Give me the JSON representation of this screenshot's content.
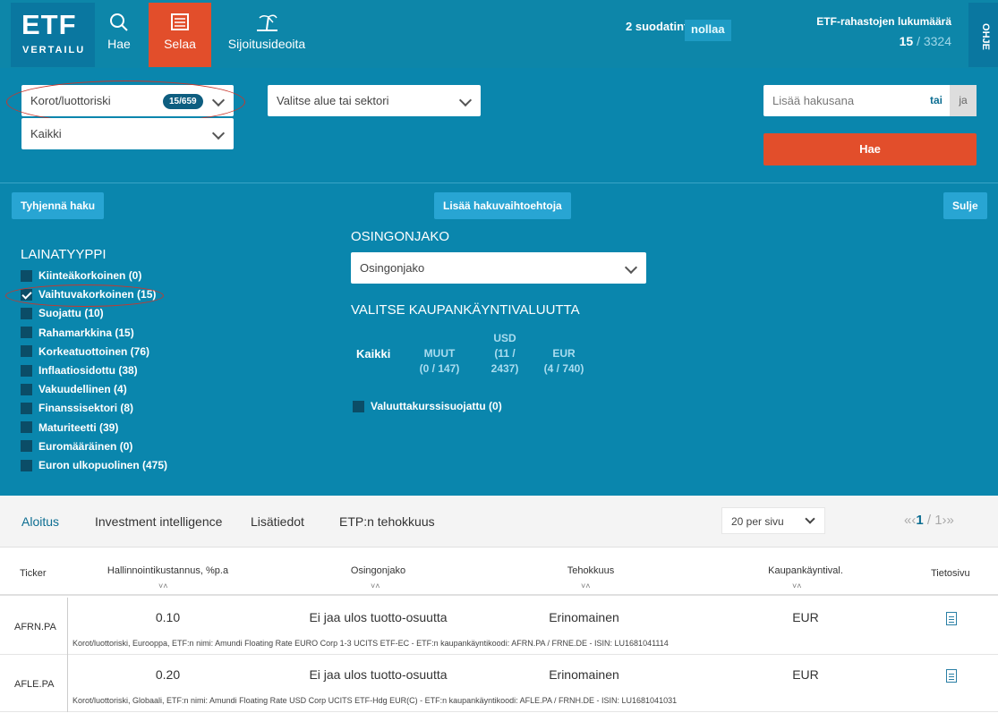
{
  "logo": {
    "title": "ETF",
    "subtitle": "VERTAILU"
  },
  "nav": {
    "hae": {
      "label": "Hae",
      "icon": "search-icon"
    },
    "selaa": {
      "label": "Selaa",
      "icon": "list-icon"
    },
    "sijoitusideoita": {
      "label": "Sijoitusideoita",
      "icon": "palm-island-icon"
    }
  },
  "filters": {
    "count_text": "2 suodatinta",
    "reset_label": "nollaa"
  },
  "fund_count": {
    "title": "ETF-rahastojen lukumäärä",
    "shown": "15",
    "total": "/ 3324"
  },
  "ohje": "OHJE",
  "search": {
    "category": {
      "value": "Korot/luottoriski",
      "badge": "15/659"
    },
    "sub_category": {
      "value": "Kaikki"
    },
    "region": {
      "value": "Valitse alue tai sektori"
    },
    "keyword": {
      "placeholder": "Lisää hakusana",
      "tai": "tai",
      "ja": "ja"
    },
    "submit": "Hae",
    "clear": "Tyhjennä haku",
    "more_options": "Lisää hakuvaihtoehtoja",
    "close": "Sulje"
  },
  "lainatyyppi": {
    "title": "LAINATYYPPI",
    "items": [
      {
        "label": "Kiinteäkorkoinen (0)",
        "checked": false
      },
      {
        "label": "Vaihtuvakorkoinen (15)",
        "checked": true
      },
      {
        "label": "Suojattu (10)",
        "checked": false
      },
      {
        "label": "Rahamarkkina (15)",
        "checked": false
      },
      {
        "label": "Korkeatuottoinen (76)",
        "checked": false
      },
      {
        "label": "Inflaatiosidottu (38)",
        "checked": false
      },
      {
        "label": "Vakuudellinen (4)",
        "checked": false
      },
      {
        "label": "Finanssisektori (8)",
        "checked": false
      },
      {
        "label": "Maturiteetti (39)",
        "checked": false
      },
      {
        "label": "Euromääräinen (0)",
        "checked": false
      },
      {
        "label": "Euron ulkopuolinen (475)",
        "checked": false
      }
    ]
  },
  "osingonjako": {
    "title": "OSINGONJAKO",
    "value": "Osingonjako"
  },
  "valuutta": {
    "title": "VALITSE KAUPANKÄYNTIVALUUTTA",
    "kaikki": "Kaikki",
    "muut": {
      "name": "MUUT",
      "count": "(0 / 147)"
    },
    "usd": {
      "name": "USD",
      "count1": "(11 /",
      "count2": "2437)"
    },
    "eur": {
      "name": "EUR",
      "count": "(4 / 740)"
    },
    "hedged": "Valuuttakurssisuojattu (0)"
  },
  "tabs": [
    "Aloitus",
    "Investment intelligence",
    "Lisätiedot",
    "ETP:n tehokkuus"
  ],
  "per_page": "20 per sivu",
  "pager": {
    "prev": "«‹",
    "current": "1",
    "sep": " / ",
    "total": "1",
    "next": "›»"
  },
  "columns": {
    "ticker": "Ticker",
    "cost": "Hallinnointikustannus, %p.a",
    "dividend": "Osingonjako",
    "efficiency": "Tehokkuus",
    "currency": "Kaupankäyntival.",
    "info": "Tietosivu"
  },
  "sort_arrows": "˅˄",
  "rows": [
    {
      "ticker": "AFRN.PA",
      "cost": "0.10",
      "dividend": "Ei jaa ulos tuotto-osuutta",
      "efficiency": "Erinomainen",
      "currency": "EUR",
      "desc": "Korot/luottoriski, Eurooppa, ETF:n nimi: Amundi Floating Rate EURO Corp 1-3 UCITS ETF-EC - ETF:n kaupankäyntikoodi: AFRN.PA / FRNE.DE - ISIN: LU1681041114"
    },
    {
      "ticker": "AFLE.PA",
      "cost": "0.20",
      "dividend": "Ei jaa ulos tuotto-osuutta",
      "efficiency": "Erinomainen",
      "currency": "EUR",
      "desc": "Korot/luottoriski, Globaali, ETF:n nimi: Amundi Floating Rate USD Corp UCITS ETF-Hdg EUR(C) - ETF:n kaupankäyntikoodi: AFLE.PA / FRNH.DE - ISIN: LU1681041031"
    }
  ]
}
